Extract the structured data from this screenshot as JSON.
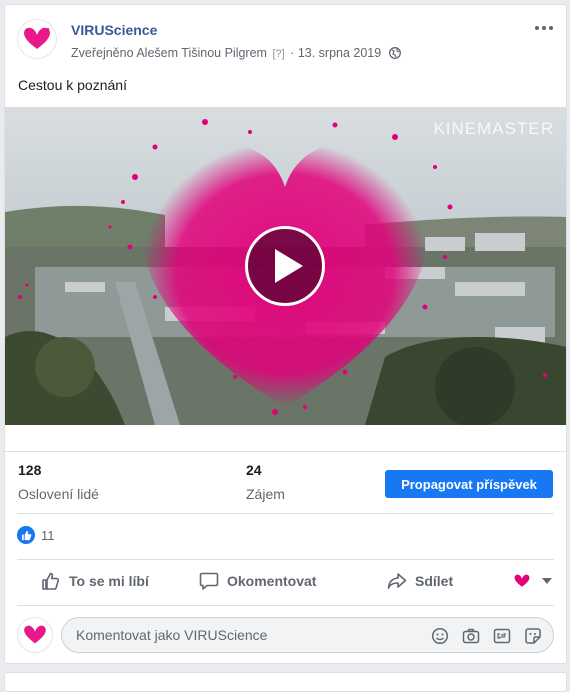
{
  "post": {
    "page_name": "VIRUScience",
    "published_prefix": "Zveřejněno",
    "author": "Alešem Tišinou Pilgrem",
    "help_marker": "[?]",
    "separator": "·",
    "date": "13. srpna 2019",
    "text": "Cestou k poznání"
  },
  "video": {
    "watermark": "KINEMASTER"
  },
  "stats": {
    "reach_value": "128",
    "reach_label": "Oslovení lidé",
    "engagement_value": "24",
    "engagement_label": "Zájem",
    "promote_label": "Propagovat příspěvek"
  },
  "reactions": {
    "count": "11"
  },
  "actions": {
    "like": "To se mi líbí",
    "comment": "Okomentovat",
    "share": "Sdílet"
  },
  "composer": {
    "placeholder": "Komentovat jako VIRUScience"
  },
  "colors": {
    "brand": "#e6007e",
    "link": "#385898",
    "primary_button": "#1877f2"
  }
}
